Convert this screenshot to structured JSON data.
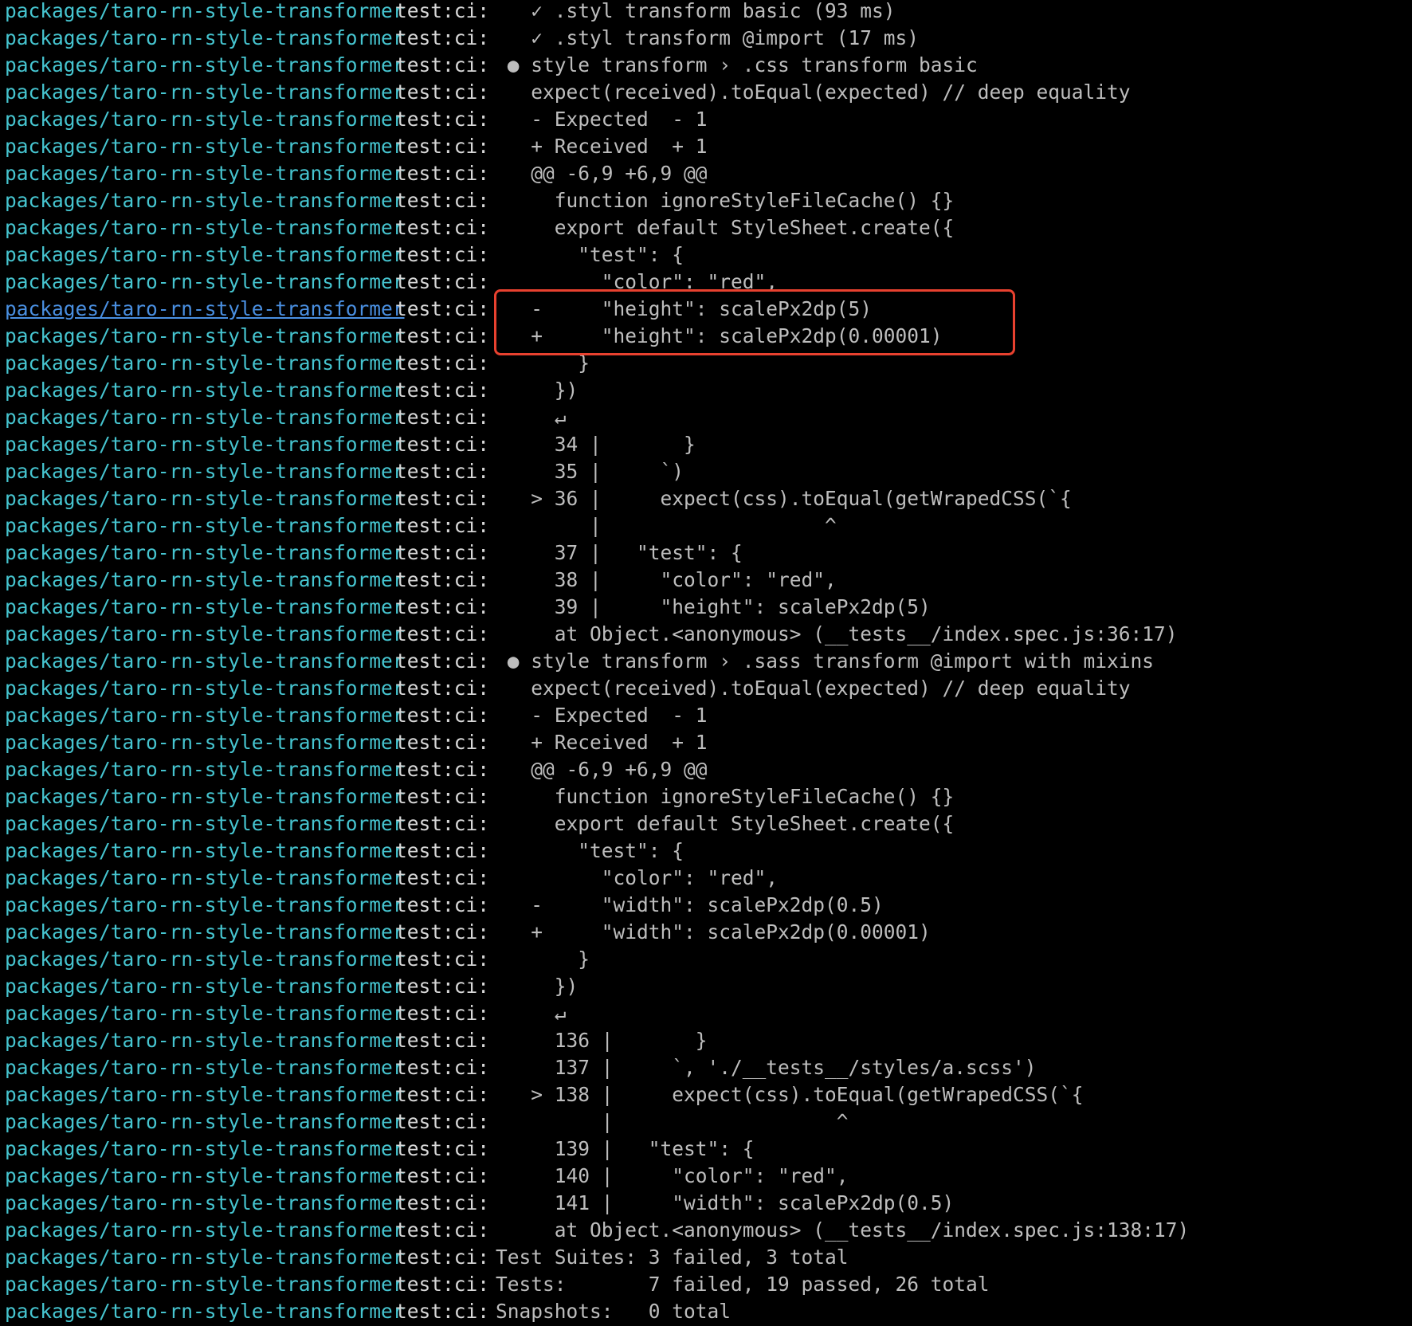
{
  "terminal": {
    "prefix": "packages/taro-rn-style-transformer",
    "script": "test:ci:",
    "lines": [
      {
        "content": "   ✓ .styl transform basic (93 ms)"
      },
      {
        "content": "   ✓ .styl transform @import (17 ms)"
      },
      {
        "content": " ● style transform › .css transform basic"
      },
      {
        "content": "   expect(received).toEqual(expected) // deep equality"
      },
      {
        "content": "   - Expected  - 1"
      },
      {
        "content": "   + Received  + 1"
      },
      {
        "content": "   @@ -6,9 +6,9 @@"
      },
      {
        "content": "     function ignoreStyleFileCache() {}"
      },
      {
        "content": "     export default StyleSheet.create({"
      },
      {
        "content": "       \"test\": {"
      },
      {
        "content": "         \"color\": \"red\","
      },
      {
        "content": "   -     \"height\": scalePx2dp(5)",
        "link": true
      },
      {
        "content": "   +     \"height\": scalePx2dp(0.00001)"
      },
      {
        "content": "       }"
      },
      {
        "content": "     })"
      },
      {
        "content": "     ↵"
      },
      {
        "content": "     34 |       }"
      },
      {
        "content": "     35 |     `)"
      },
      {
        "content": "   > 36 |     expect(css).toEqual(getWrapedCSS(`{"
      },
      {
        "content": "        |                   ^"
      },
      {
        "content": "     37 |   \"test\": {"
      },
      {
        "content": "     38 |     \"color\": \"red\","
      },
      {
        "content": "     39 |     \"height\": scalePx2dp(5)"
      },
      {
        "content": "     at Object.<anonymous> (__tests__/index.spec.js:36:17)"
      },
      {
        "content": " ● style transform › .sass transform @import with mixins"
      },
      {
        "content": "   expect(received).toEqual(expected) // deep equality"
      },
      {
        "content": "   - Expected  - 1"
      },
      {
        "content": "   + Received  + 1"
      },
      {
        "content": "   @@ -6,9 +6,9 @@"
      },
      {
        "content": "     function ignoreStyleFileCache() {}"
      },
      {
        "content": "     export default StyleSheet.create({"
      },
      {
        "content": "       \"test\": {"
      },
      {
        "content": "         \"color\": \"red\","
      },
      {
        "content": "   -     \"width\": scalePx2dp(0.5)"
      },
      {
        "content": "   +     \"width\": scalePx2dp(0.00001)"
      },
      {
        "content": "       }"
      },
      {
        "content": "     })"
      },
      {
        "content": "     ↵"
      },
      {
        "content": "     136 |       }"
      },
      {
        "content": "     137 |     `, './__tests__/styles/a.scss')"
      },
      {
        "content": "   > 138 |     expect(css).toEqual(getWrapedCSS(`{"
      },
      {
        "content": "         |                   ^"
      },
      {
        "content": "     139 |   \"test\": {"
      },
      {
        "content": "     140 |     \"color\": \"red\","
      },
      {
        "content": "     141 |     \"width\": scalePx2dp(0.5)"
      },
      {
        "content": "     at Object.<anonymous> (__tests__/index.spec.js:138:17)"
      },
      {
        "content": "Test Suites: 3 failed, 3 total"
      },
      {
        "content": "Tests:       7 failed, 19 passed, 26 total"
      },
      {
        "content": "Snapshots:   0 total"
      }
    ]
  },
  "colors": {
    "background": "#000000",
    "prefix": "#46c5d0",
    "link": "#4a90e2",
    "highlight": "#e8412f"
  }
}
